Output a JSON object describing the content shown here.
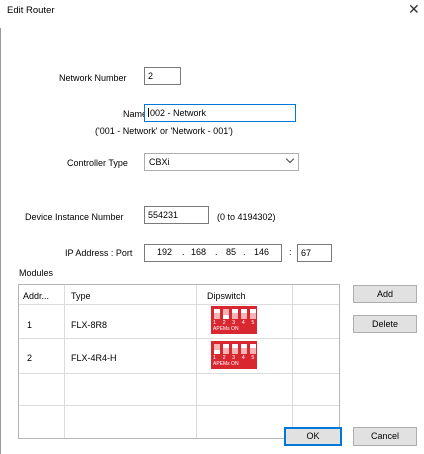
{
  "window": {
    "title": "Edit Router"
  },
  "form": {
    "network_number_label": "Network Number",
    "network_number_value": "2",
    "name_label": "Name",
    "name_value": "002 - Network",
    "name_hint": "('001 - Network' or 'Network - 001')",
    "controller_type_label": "Controller Type",
    "controller_type_value": "CBXi",
    "device_instance_label": "Device Instance Number",
    "device_instance_value": "554231",
    "device_instance_range": "(0 to 4194302)",
    "ip_label": "IP Address : Port",
    "ip_octets": [
      "192",
      "168",
      "85",
      "146"
    ],
    "ip_dot": ".",
    "ip_colon": ":",
    "port_value": "67"
  },
  "modules": {
    "label": "Modules",
    "columns": [
      "Addr...",
      "Type",
      "Dipswitch"
    ],
    "rows": [
      {
        "addr": "1",
        "type": "FLX-8R8",
        "dip_numbers": "1 2 3 4 5",
        "dip_text": "APEMs ON"
      },
      {
        "addr": "2",
        "type": "FLX-4R4-H",
        "dip_numbers": "1 2 3 4 5",
        "dip_text": "APEMs ON"
      }
    ]
  },
  "buttons": {
    "add": "Add",
    "delete": "Delete",
    "ok": "OK",
    "cancel": "Cancel"
  },
  "colors": {
    "accent": "#0078d7",
    "dipswitch_red": "#d9272f"
  },
  "icons": {
    "close": "close-icon",
    "dropdown": "chevron-down-icon"
  }
}
